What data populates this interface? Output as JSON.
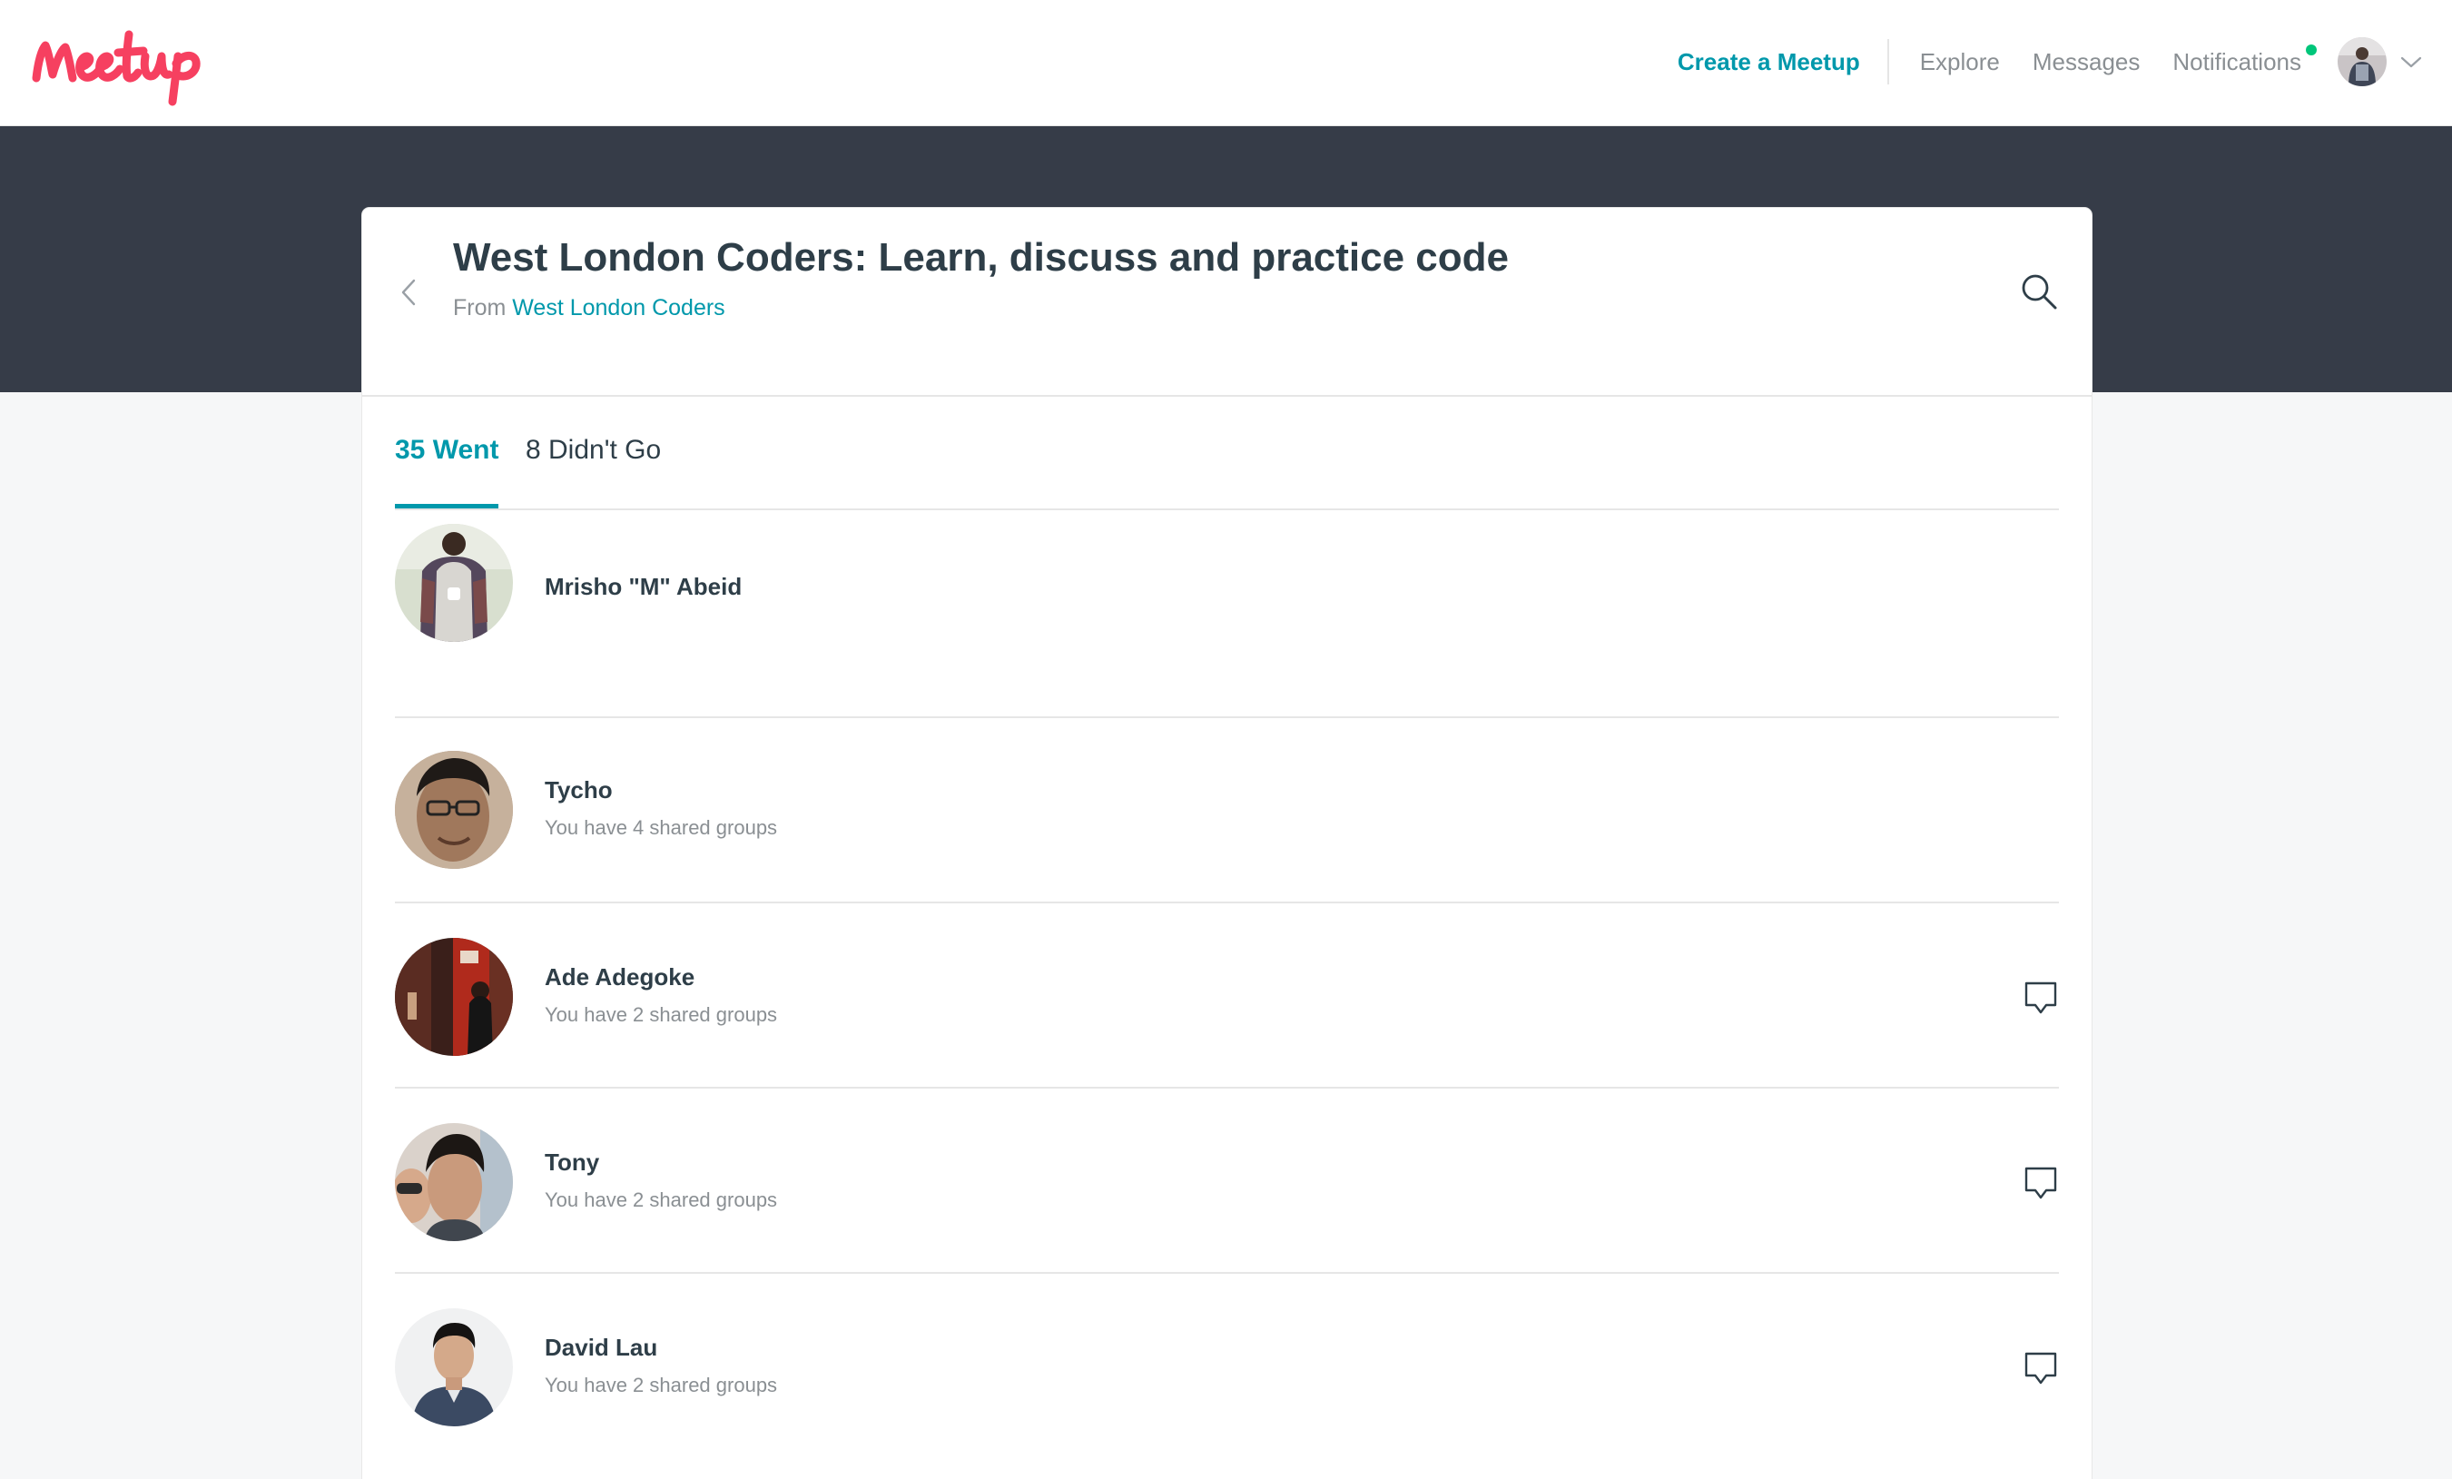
{
  "nav": {
    "create_label": "Create a Meetup",
    "explore_label": "Explore",
    "messages_label": "Messages",
    "notifications_label": "Notifications",
    "brand_color": "#f64060",
    "accent_color": "#0098ab",
    "notification_dot_color": "#00c67a"
  },
  "event": {
    "title": "West London Coders: Learn, discuss and practice code",
    "from_prefix": "From",
    "group_name": "West London Coders"
  },
  "tabs": {
    "went_label": "35 Went",
    "not_went_label": "8 Didn't Go"
  },
  "attendees": [
    {
      "name": "Mrisho \"M\" Abeid",
      "shared": ""
    },
    {
      "name": "Tycho",
      "shared": "You have 4 shared groups"
    },
    {
      "name": "Ade Adegoke",
      "shared": "You have 2 shared groups"
    },
    {
      "name": "Tony",
      "shared": "You have 2 shared groups"
    },
    {
      "name": "David Lau",
      "shared": "You have 2 shared groups"
    }
  ],
  "icons": {
    "search": "search-icon",
    "back": "chevron-left-icon",
    "message": "chat-bubble-icon",
    "menu": "chevron-down-icon"
  }
}
